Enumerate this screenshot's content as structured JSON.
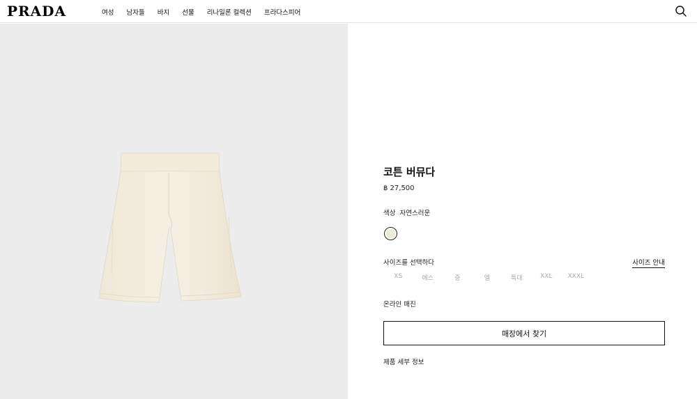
{
  "brand": {
    "logo_text": "PRADA"
  },
  "nav": {
    "items": [
      {
        "label": "여성"
      },
      {
        "label": "남자들"
      },
      {
        "label": "바지"
      },
      {
        "label": "선물"
      },
      {
        "label": "리나일론 컬렉션"
      },
      {
        "label": "프라다스피어"
      }
    ]
  },
  "header": {
    "search_icon": "search-icon"
  },
  "product": {
    "title": "코튼 버뮤다",
    "price": "฿ 27,500",
    "color_label": "색상",
    "color_value": "자연스러운",
    "swatch_color": "#f1e9dc",
    "size_label": "사이즈를 선택하다",
    "size_guide": "사이즈 안내",
    "sizes": [
      "XS",
      "에스",
      "중",
      "엘",
      "특대",
      "XXL",
      "XXXL"
    ],
    "availability": "온라인 매진",
    "store_button": "매장에서 찾기",
    "details_link": "제품 세부 정보",
    "image_bg": "#ececec",
    "product_color": "#f3ecde"
  }
}
